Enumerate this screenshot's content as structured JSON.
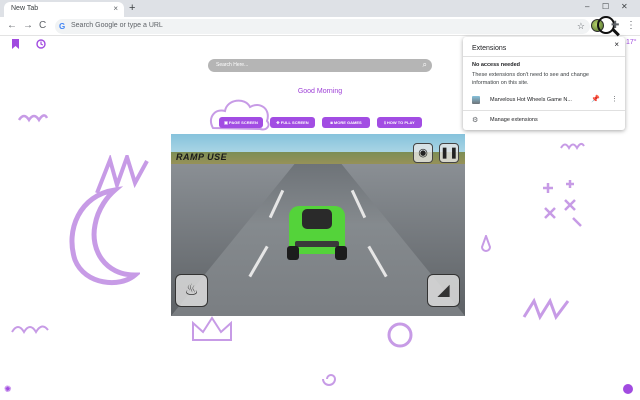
{
  "browser": {
    "tab_title": "New Tab",
    "tab_close": "×",
    "new_tab": "+",
    "minimize": "–",
    "maximize": "☐",
    "close": "✕",
    "back": "←",
    "forward": "→",
    "reload": "C",
    "google_g": "G",
    "omnibox_placeholder": "Search Google or type a URL",
    "star": "☆",
    "puzzle": "✚",
    "menu": "⋮"
  },
  "page": {
    "bookmark_icon": "bookmark-icon",
    "history_icon": "history-icon",
    "search_placeholder": "Search Here...",
    "greeting": "Good Morning",
    "weather_temp": "17°",
    "buttons": [
      {
        "label": "PAGE SCREEN"
      },
      {
        "label": "FULL SCREEN"
      },
      {
        "label": "MORE GAMES"
      },
      {
        "label": "HOW TO PLAY"
      }
    ]
  },
  "game": {
    "hud_label": "RAMP USE",
    "camera_icon": "camera-icon",
    "pause_icon": "pause-icon",
    "nitro_icon": "nitro-icon",
    "ramp_icon": "ramp-icon"
  },
  "extensions_popup": {
    "title": "Extensions",
    "close": "×",
    "heading": "No access needed",
    "description": "These extensions don't need to see and change information on this site.",
    "item_name": "Marvelous Hot Wheels Game N...",
    "pin": "📌",
    "more": "⋮",
    "manage_label": "Manage extensions",
    "gear": "⚙"
  },
  "colors": {
    "accent": "#a24de3",
    "doodle": "#c79be6",
    "chrome_tabstrip": "#dee1e6",
    "car": "#54d33a"
  }
}
